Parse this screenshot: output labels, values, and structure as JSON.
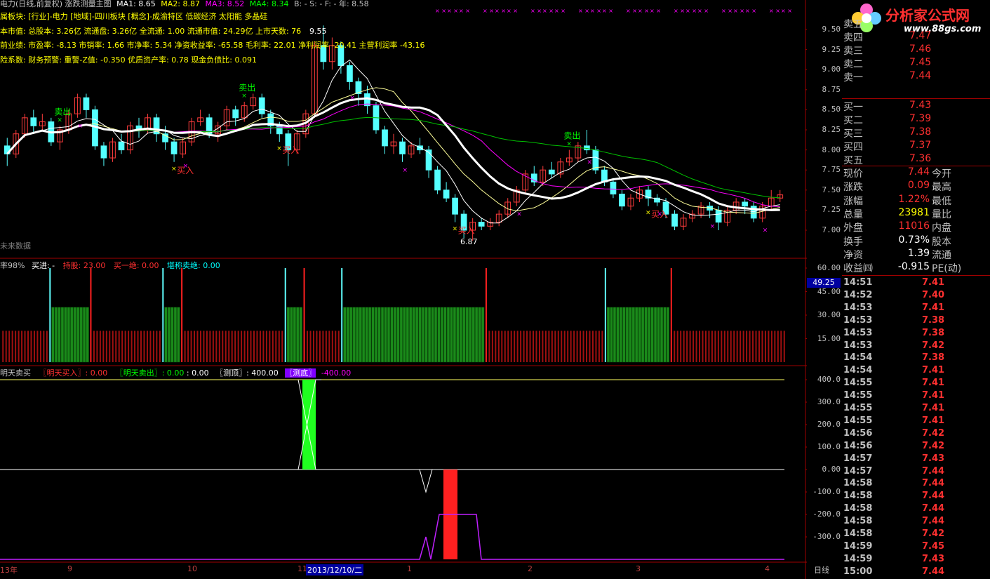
{
  "header": {
    "title": "电力(日线,前复权) 涨跌测量主图",
    "ma1": "MA1: 8.65",
    "ma2": "MA2: 8.87",
    "ma3": "MA3: 8.52",
    "ma4": "MA4: 8.34",
    "ma_extra": "B: -  S: -  F: -  年: 8.58",
    "sector": "属板块: [行业]-电力 [地域]-四川板块 [概念]-成渝特区 低碳经济 太阳能 多晶硅",
    "basic": "本市值: 总股本: 3.26亿 流通盘: 3.26亿 全流通: 1.00 流通市值: 24.29亿 上市天数: 76",
    "perf": "前业绩: 市盈率: -8.13 市销率: 1.66 市净率: 5.34 净资收益率: -65.58 毛利率: 22.01 净利润率 -20.41 主营利润率 -43.16",
    "risk": "险系数: 财务预警: 重警-Z值: -0.350 优质资产率: 0.78 现金负债比: 0.091",
    "no_future": "未来数据",
    "hi_label": "9.55",
    "lo_label": "6.87"
  },
  "price_axis": [
    "9.50",
    "9.25",
    "9.00",
    "8.75",
    "8.50",
    "8.25",
    "8.00",
    "7.75",
    "7.50",
    "7.25",
    "7.00"
  ],
  "annotations": {
    "sell": "卖出",
    "buy": "买入"
  },
  "middle_header": {
    "rate": "率98%",
    "buy_in": "买进: -",
    "hold": "持股: 23.00",
    "buy_all": "买一绝: 0.00",
    "sell_all": "堪称卖绝: 0.00",
    "value_box": "49.25"
  },
  "middle_axis": [
    "60.00",
    "45.00",
    "30.00",
    "15.00"
  ],
  "bottom_header": {
    "title": "明天卖买",
    "buy_tmr": "〖明天买入〗: 0.00",
    "sell_tmr": "〖明天卖出〗: 0.00",
    "extra": ": 0.00",
    "top": "〖测顶〗: 400.00",
    "bottom": "〖测底〗",
    "bottom_val": "-400.00"
  },
  "bottom_axis": [
    "400.0",
    "300.0",
    "200.0",
    "100.0",
    "0.00",
    "-100.0",
    "-200.0",
    "-300.0"
  ],
  "date_axis": {
    "labels": [
      "13年",
      "9",
      "10",
      "11",
      "1",
      "2",
      "3",
      "4"
    ],
    "cursor_date": "2013/12/10/二",
    "period": "日线"
  },
  "logo": {
    "name": "分析家公式网",
    "url": "www.88gs.com"
  },
  "order_book": {
    "sells": [
      {
        "label": "卖五",
        "price": ""
      },
      {
        "label": "卖四",
        "price": "7.47"
      },
      {
        "label": "卖三",
        "price": "7.46"
      },
      {
        "label": "卖二",
        "price": "7.45"
      },
      {
        "label": "卖一",
        "price": "7.44"
      }
    ],
    "buys": [
      {
        "label": "买一",
        "price": "7.43"
      },
      {
        "label": "买二",
        "price": "7.39"
      },
      {
        "label": "买三",
        "price": "7.38"
      },
      {
        "label": "买四",
        "price": "7.37"
      },
      {
        "label": "买五",
        "price": "7.36"
      }
    ]
  },
  "quote": [
    {
      "k1": "现价",
      "v1": "7.44",
      "c1": "#ff3030",
      "k2": "今开"
    },
    {
      "k1": "涨跌",
      "v1": "0.09",
      "c1": "#ff3030",
      "k2": "最高"
    },
    {
      "k1": "涨幅",
      "v1": "1.22%",
      "c1": "#ff3030",
      "k2": "最低"
    },
    {
      "k1": "总量",
      "v1": "23981",
      "c1": "#ffff00",
      "k2": "量比"
    },
    {
      "k1": "外盘",
      "v1": "11016",
      "c1": "#ff3030",
      "k2": "内盘"
    },
    {
      "k1": "换手",
      "v1": "0.73%",
      "c1": "#ffffff",
      "k2": "股本"
    },
    {
      "k1": "净资",
      "v1": "1.39",
      "c1": "#ffffff",
      "k2": "流通"
    },
    {
      "k1": "收益㈣",
      "v1": "-0.915",
      "c1": "#ffffff",
      "k2": "PE(动)"
    }
  ],
  "ticks": [
    {
      "t": "14:51",
      "p": "7.41"
    },
    {
      "t": "14:52",
      "p": "7.40"
    },
    {
      "t": "14:53",
      "p": "7.41"
    },
    {
      "t": "14:53",
      "p": "7.38"
    },
    {
      "t": "14:53",
      "p": "7.38"
    },
    {
      "t": "14:53",
      "p": "7.42"
    },
    {
      "t": "14:54",
      "p": "7.38"
    },
    {
      "t": "14:54",
      "p": "7.41"
    },
    {
      "t": "14:55",
      "p": "7.41"
    },
    {
      "t": "14:55",
      "p": "7.41"
    },
    {
      "t": "14:55",
      "p": "7.41"
    },
    {
      "t": "14:55",
      "p": "7.41"
    },
    {
      "t": "14:56",
      "p": "7.42"
    },
    {
      "t": "14:56",
      "p": "7.42"
    },
    {
      "t": "14:57",
      "p": "7.43"
    },
    {
      "t": "14:57",
      "p": "7.44"
    },
    {
      "t": "14:58",
      "p": "7.44"
    },
    {
      "t": "14:58",
      "p": "7.44"
    },
    {
      "t": "14:58",
      "p": "7.44"
    },
    {
      "t": "14:58",
      "p": "7.44"
    },
    {
      "t": "14:58",
      "p": "7.42"
    },
    {
      "t": "14:59",
      "p": "7.45"
    },
    {
      "t": "14:59",
      "p": "7.43"
    },
    {
      "t": "15:00",
      "p": "7.44"
    }
  ],
  "chart_data": {
    "type": "candlestick",
    "price_candles": [
      [
        8.05,
        7.95,
        8.15,
        7.8
      ],
      [
        7.95,
        8.2,
        8.25,
        7.9
      ],
      [
        8.2,
        8.4,
        8.45,
        8.15
      ],
      [
        8.4,
        8.3,
        8.5,
        8.2
      ],
      [
        8.3,
        8.35,
        8.45,
        8.25
      ],
      [
        8.35,
        8.1,
        8.4,
        8.05
      ],
      [
        8.1,
        8.25,
        8.3,
        8.0
      ],
      [
        8.25,
        8.45,
        8.5,
        8.2
      ],
      [
        8.45,
        8.65,
        8.7,
        8.4
      ],
      [
        8.65,
        8.5,
        8.7,
        8.4
      ],
      [
        8.5,
        8.05,
        8.55,
        8.0
      ],
      [
        8.05,
        7.9,
        8.1,
        7.8
      ],
      [
        7.9,
        8.1,
        8.15,
        7.85
      ],
      [
        8.1,
        8.0,
        8.2,
        7.95
      ],
      [
        8.0,
        8.3,
        8.35,
        7.95
      ],
      [
        8.3,
        8.25,
        8.4,
        8.15
      ],
      [
        8.25,
        8.4,
        8.45,
        8.2
      ],
      [
        8.4,
        8.2,
        8.45,
        8.1
      ],
      [
        8.2,
        8.1,
        8.3,
        8.0
      ],
      [
        8.1,
        7.95,
        8.15,
        7.85
      ],
      [
        7.95,
        8.1,
        8.15,
        7.9
      ],
      [
        8.1,
        8.35,
        8.4,
        8.05
      ],
      [
        8.35,
        8.4,
        8.5,
        8.3
      ],
      [
        8.4,
        8.2,
        8.45,
        8.15
      ],
      [
        8.2,
        8.3,
        8.35,
        8.1
      ],
      [
        8.3,
        8.5,
        8.55,
        8.25
      ],
      [
        8.5,
        8.4,
        8.55,
        8.3
      ],
      [
        8.4,
        8.55,
        8.6,
        8.35
      ],
      [
        8.55,
        8.65,
        8.7,
        8.5
      ],
      [
        8.65,
        8.45,
        8.7,
        8.4
      ],
      [
        8.45,
        8.3,
        8.5,
        8.2
      ],
      [
        8.3,
        8.2,
        8.35,
        8.1
      ],
      [
        8.2,
        8.0,
        8.25,
        7.8
      ],
      [
        8.0,
        8.2,
        8.25,
        7.95
      ],
      [
        8.2,
        8.45,
        8.5,
        8.15
      ],
      [
        8.45,
        9.3,
        9.35,
        8.4
      ],
      [
        9.3,
        9.1,
        9.55,
        9.0
      ],
      [
        9.1,
        9.3,
        9.4,
        9.0
      ],
      [
        9.3,
        9.05,
        9.35,
        8.95
      ],
      [
        9.05,
        8.85,
        9.1,
        8.75
      ],
      [
        8.85,
        8.7,
        8.9,
        8.55
      ],
      [
        8.7,
        8.55,
        8.8,
        8.45
      ],
      [
        8.55,
        8.25,
        8.6,
        8.2
      ],
      [
        8.25,
        8.05,
        8.3,
        7.95
      ],
      [
        8.05,
        8.1,
        8.2,
        7.95
      ],
      [
        8.1,
        7.95,
        8.15,
        7.85
      ],
      [
        7.95,
        8.05,
        8.1,
        7.9
      ],
      [
        8.05,
        8.0,
        8.15,
        7.95
      ],
      [
        8.0,
        7.75,
        8.05,
        7.65
      ],
      [
        7.75,
        7.5,
        7.8,
        7.45
      ],
      [
        7.5,
        7.4,
        7.6,
        7.35
      ],
      [
        7.4,
        7.2,
        7.45,
        7.1
      ],
      [
        7.2,
        7.0,
        7.25,
        6.9
      ],
      [
        7.0,
        7.1,
        7.15,
        6.87
      ],
      [
        7.1,
        7.05,
        7.15,
        7.0
      ],
      [
        7.05,
        7.1,
        7.15,
        7.0
      ],
      [
        7.1,
        7.2,
        7.25,
        7.05
      ],
      [
        7.2,
        7.35,
        7.4,
        7.15
      ],
      [
        7.35,
        7.5,
        7.55,
        7.3
      ],
      [
        7.5,
        7.7,
        7.75,
        7.45
      ],
      [
        7.7,
        7.6,
        7.8,
        7.55
      ],
      [
        7.6,
        7.75,
        7.8,
        7.55
      ],
      [
        7.75,
        7.7,
        7.85,
        7.65
      ],
      [
        7.7,
        7.85,
        7.9,
        7.65
      ],
      [
        7.85,
        7.9,
        8.0,
        7.8
      ],
      [
        7.9,
        8.05,
        8.1,
        7.85
      ],
      [
        8.05,
        8.0,
        8.25,
        7.95
      ],
      [
        8.0,
        7.75,
        8.05,
        7.7
      ],
      [
        7.75,
        7.6,
        7.8,
        7.55
      ],
      [
        7.6,
        7.45,
        7.65,
        7.4
      ],
      [
        7.45,
        7.3,
        7.5,
        7.25
      ],
      [
        7.3,
        7.4,
        7.45,
        7.25
      ],
      [
        7.4,
        7.5,
        7.55,
        7.35
      ],
      [
        7.5,
        7.4,
        7.55,
        7.3
      ],
      [
        7.4,
        7.35,
        7.45,
        7.3
      ],
      [
        7.35,
        7.2,
        7.4,
        7.15
      ],
      [
        7.2,
        7.05,
        7.25,
        7.0
      ],
      [
        7.05,
        7.15,
        7.2,
        7.0
      ],
      [
        7.15,
        7.2,
        7.25,
        7.1
      ],
      [
        7.2,
        7.3,
        7.35,
        7.15
      ],
      [
        7.3,
        7.25,
        7.35,
        7.15
      ],
      [
        7.25,
        7.1,
        7.3,
        7.0
      ],
      [
        7.1,
        7.25,
        7.3,
        7.05
      ],
      [
        7.25,
        7.35,
        7.4,
        7.2
      ],
      [
        7.35,
        7.3,
        7.4,
        7.2
      ],
      [
        7.3,
        7.15,
        7.35,
        7.1
      ],
      [
        7.15,
        7.3,
        7.35,
        7.1
      ],
      [
        7.3,
        7.4,
        7.5,
        7.25
      ],
      [
        7.4,
        7.44,
        7.5,
        7.35
      ]
    ],
    "middle_bars": [
      20,
      20,
      20,
      20,
      20,
      20,
      20,
      20,
      20,
      20,
      20,
      20,
      20,
      20,
      20,
      60,
      35,
      35,
      35,
      35,
      35,
      35,
      35,
      35,
      35,
      35,
      35,
      35,
      60,
      20,
      20,
      20,
      20,
      20,
      20,
      20,
      20,
      20,
      20,
      20,
      20,
      20,
      20,
      20,
      20,
      20,
      20,
      20,
      20,
      20,
      20,
      60,
      35,
      35,
      35,
      35,
      35,
      60,
      20,
      20,
      20,
      20,
      20,
      20,
      20,
      20,
      20,
      20,
      20,
      20,
      20,
      20,
      20,
      20,
      20,
      20,
      20,
      20,
      20,
      20,
      20,
      20,
      20,
      20,
      20,
      20,
      20,
      20,
      20,
      20,
      60,
      35,
      35,
      35,
      35,
      35,
      60,
      20,
      20,
      20,
      20,
      20,
      20,
      20,
      20,
      20,
      20,
      20,
      60,
      35,
      35,
      35,
      35,
      35,
      35,
      35,
      35,
      35,
      35,
      35,
      35,
      35,
      35,
      35,
      35,
      35,
      35,
      35,
      35,
      35,
      35,
      35,
      35,
      35,
      35,
      35,
      35,
      35,
      35,
      35,
      35,
      35,
      35,
      35,
      35,
      35,
      35,
      35,
      35,
      35,
      35,
      35,
      35,
      35,
      60,
      20,
      20,
      20,
      20,
      20,
      20,
      20,
      20,
      20,
      20,
      20,
      20,
      20,
      20,
      20,
      20,
      20,
      20,
      20,
      20,
      20,
      20,
      20,
      20,
      20,
      20,
      20,
      20,
      20,
      20,
      20,
      20,
      20,
      20,
      20,
      20,
      20,
      60,
      35,
      35,
      35,
      35,
      35,
      35,
      35,
      35,
      35,
      35,
      35,
      35,
      35,
      35,
      35,
      35,
      35,
      35,
      35,
      35,
      60,
      20,
      20,
      20,
      20,
      20,
      20,
      20,
      20,
      20,
      20,
      20,
      20,
      20,
      20,
      20,
      20,
      20,
      20,
      20,
      20,
      20,
      20,
      20,
      20,
      20,
      20,
      20,
      20,
      20,
      20,
      20,
      20,
      20,
      20,
      20,
      20
    ]
  }
}
